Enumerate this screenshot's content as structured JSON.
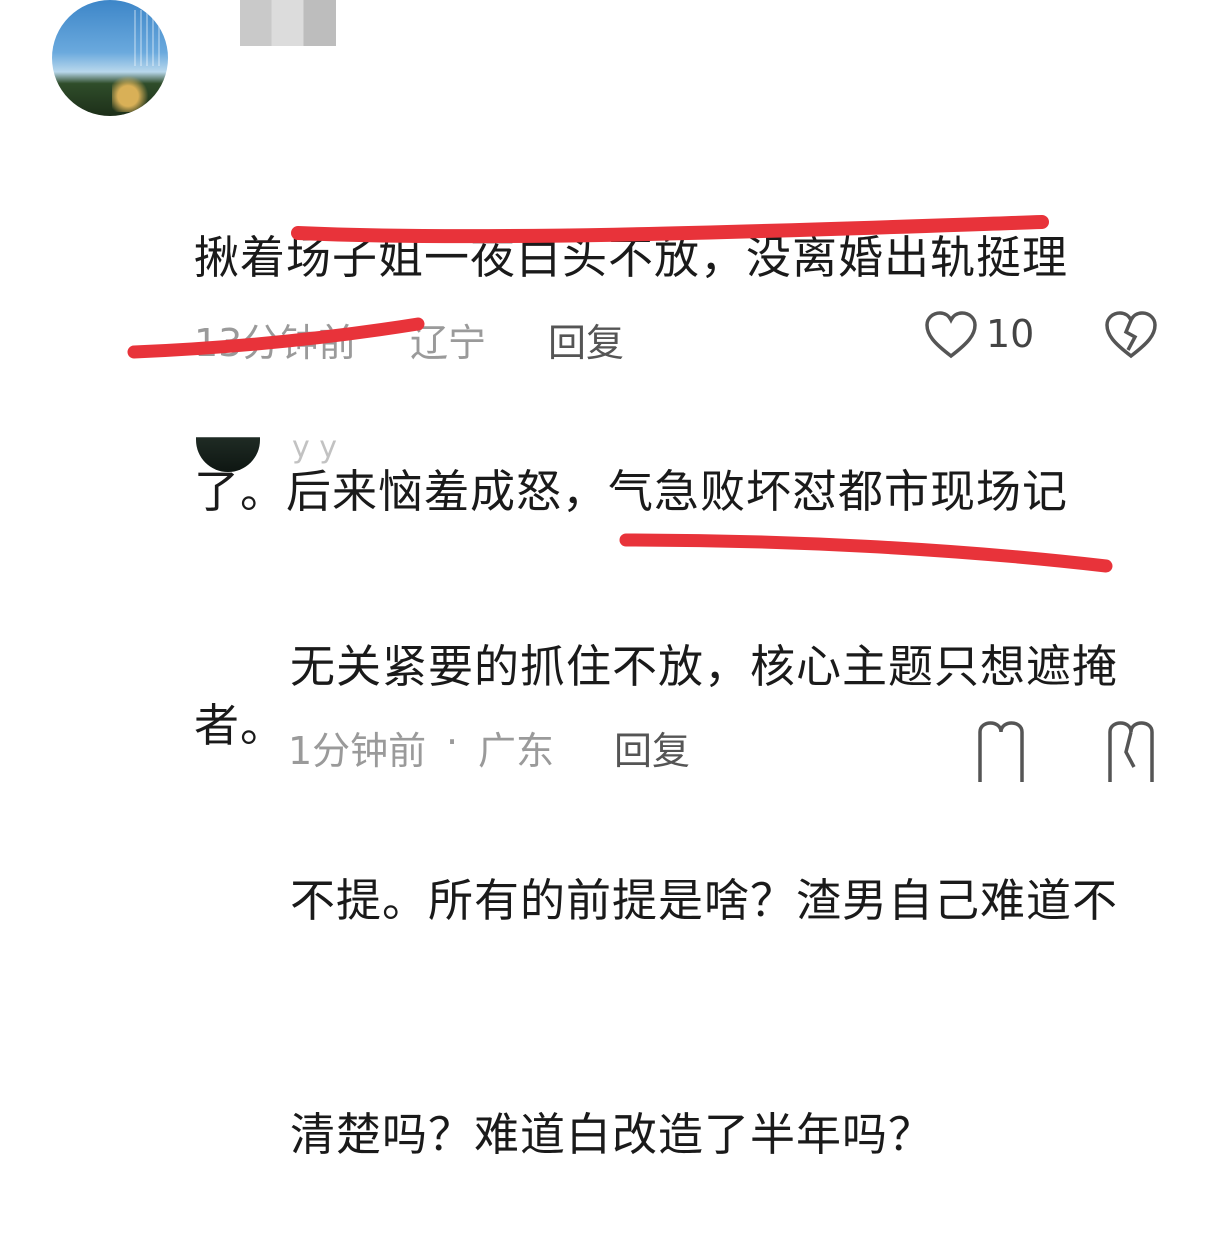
{
  "comment": {
    "text_lines": [
      "揪着场子姐一夜白头不放，没离婚出轨挺理",
      "了。后来恼羞成怒，气急败坏怼都市现场记",
      "者。"
    ],
    "time": "13分钟前",
    "location": "辽宁",
    "reply_label": "回复",
    "likes": "10"
  },
  "reply": {
    "username": "y y",
    "text_lines": [
      "无关紧要的抓住不放，核心主题只想遮掩",
      "不提。所有的前提是啥？渣男自己难道不",
      "清楚吗？难道白改造了半年吗？"
    ],
    "time": "1分钟前",
    "separator": "·",
    "location": "广东",
    "reply_label": "回复"
  },
  "colors": {
    "underline": "#e8333a",
    "meta_text": "#9a9a9a",
    "body_text": "#1a1a1a"
  },
  "icons": [
    "heart-icon",
    "broken-heart-icon"
  ]
}
